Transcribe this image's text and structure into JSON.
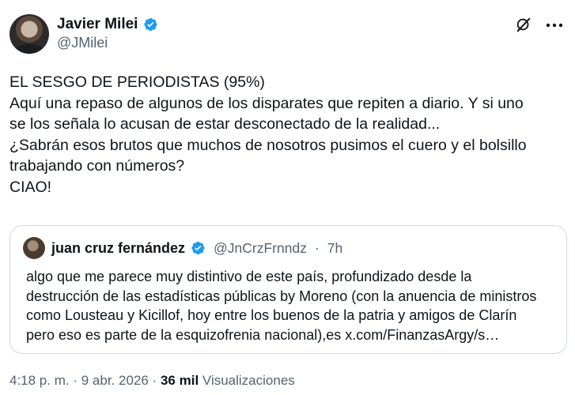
{
  "author": {
    "name": "Javier Milei",
    "handle": "@JMilei",
    "verified_color": "#1d9bf0"
  },
  "icons": {
    "avatar": "profile-photo",
    "verified": "verified-badge-icon",
    "grok": "grok-logo-icon",
    "more": "more-icon"
  },
  "tweet": {
    "lines": [
      "EL SESGO DE PERIODISTAS (95%)",
      "Aquí una repaso de algunos de los disparates que repiten a diario. Y si uno",
      "se los señala lo acusan de estar desconectado de la realidad...",
      "¿Sabrán esos brutos que muchos de nosotros pusimos el cuero y el bolsillo",
      "trabajando con números?",
      "CIAO!"
    ]
  },
  "quote": {
    "name": "juan cruz fernández",
    "handle": "@JnCrzFrnndz",
    "separator": "·",
    "time": "7h",
    "lines": [
      "algo que me parece muy distintivo de este país, profundizado desde la",
      "destrucción de las estadísticas públicas by Moreno (con la anuencia de ministros",
      "como Lousteau y Kicillof, hoy entre los buenos de la patria y amigos de Clarín",
      "pero eso es parte de la esquizofrenia nacional),es x.com/FinanzasArgy/s…"
    ]
  },
  "meta": {
    "time": "4:18 p. m.",
    "sep1": "·",
    "date": "9 abr. 2026",
    "sep2": "·",
    "views_count": "36 mil",
    "views_label": "Visualizaciones"
  }
}
